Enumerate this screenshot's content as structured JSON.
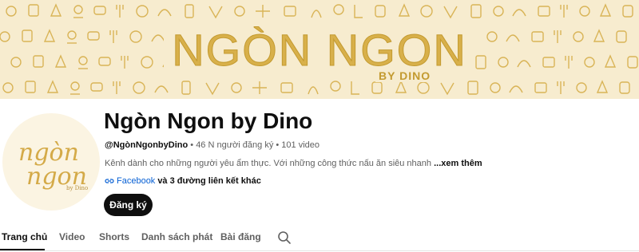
{
  "banner": {
    "title": "NGÒN NGON",
    "subtitle": "BY DINO"
  },
  "avatar": {
    "line1": "ngòn",
    "line2": "ngon",
    "line3": "by Dino"
  },
  "channel": {
    "name": "Ngòn Ngon by Dino",
    "handle": "@NgònNgonbyDino",
    "separator": " • ",
    "subscribers": "46 N người đăng ký",
    "videos": "101 video",
    "description": "Kênh dành cho những người yêu ẩm thực. Với những công thức nấu ăn siêu nhanh",
    "more_label": "...xem thêm",
    "link_label": "Facebook",
    "link_rest": "và 3 đường liên kết khác",
    "subscribe_label": "Đăng ký"
  },
  "tabs": [
    {
      "label": "Trang chủ",
      "active": true
    },
    {
      "label": "Video",
      "active": false
    },
    {
      "label": "Shorts",
      "active": false
    },
    {
      "label": "Danh sách phát",
      "active": false
    },
    {
      "label": "Bài đăng",
      "active": false
    }
  ],
  "colors": {
    "banner_bg": "#f7eccf",
    "banner_gold": "#d8b04a",
    "link_blue": "#065fd4",
    "button_bg": "#0f0f0f"
  }
}
